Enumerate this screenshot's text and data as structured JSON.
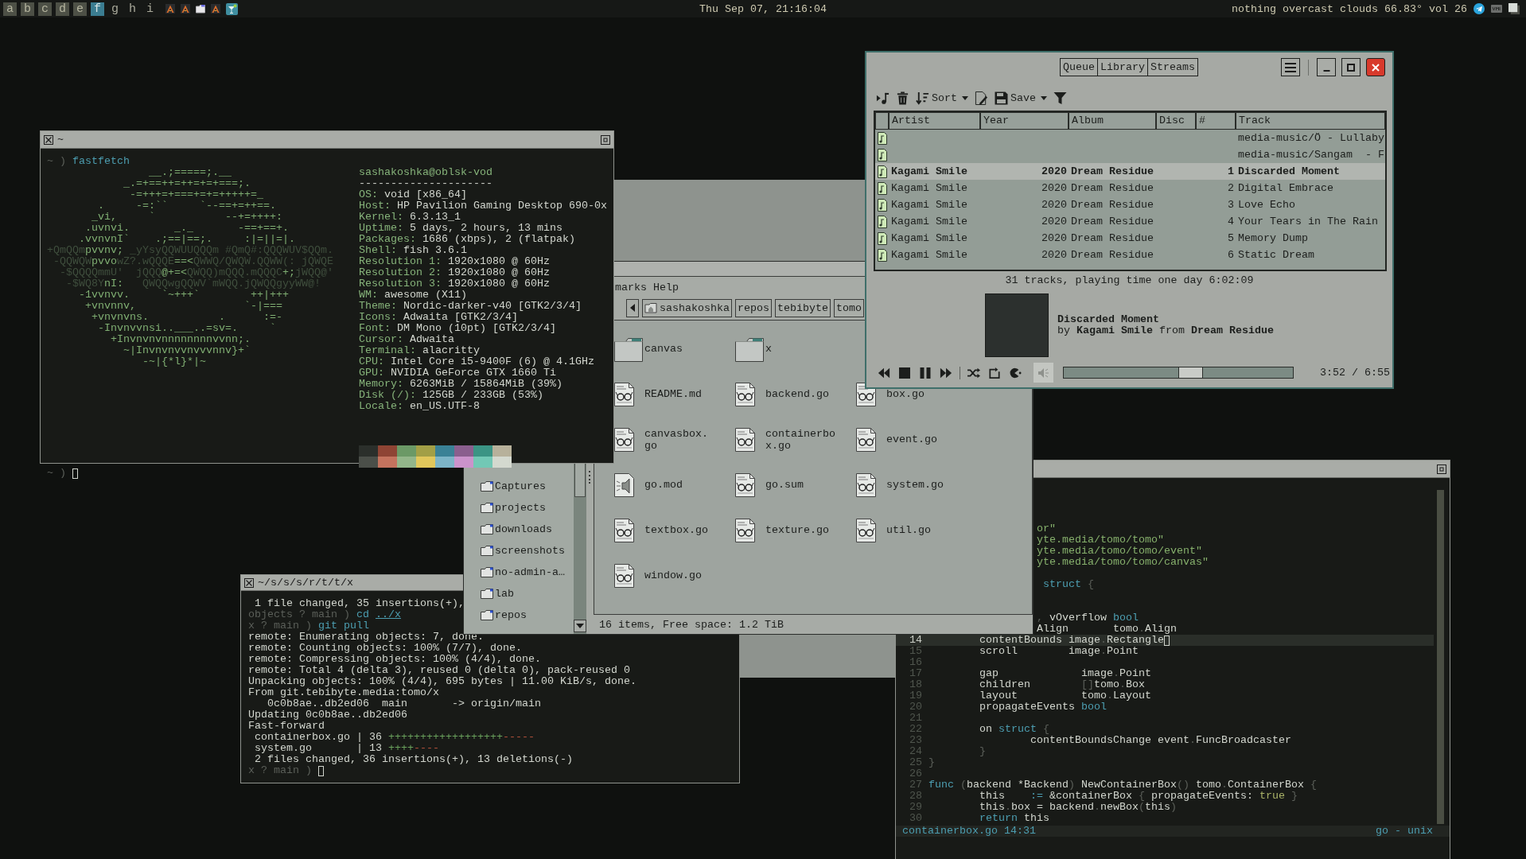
{
  "top_bar": {
    "tags": [
      {
        "label": "a",
        "occupied": true,
        "selected": false
      },
      {
        "label": "b",
        "occupied": true,
        "selected": false
      },
      {
        "label": "c",
        "occupied": true,
        "selected": false
      },
      {
        "label": "d",
        "occupied": true,
        "selected": false
      },
      {
        "label": "e",
        "occupied": true,
        "selected": false
      },
      {
        "label": "f",
        "occupied": true,
        "selected": true
      },
      {
        "label": "g",
        "occupied": false,
        "selected": false
      },
      {
        "label": "h",
        "occupied": false,
        "selected": false
      },
      {
        "label": "i",
        "occupied": false,
        "selected": false
      }
    ],
    "clock": "Thu Sep 07, 21:16:04",
    "weather": "nothing overcast clouds 66.83°",
    "volume": "vol 26"
  },
  "fetch_terminal": {
    "title": "~",
    "command": [
      {
        "text": "~ )",
        "kind": "prompt"
      },
      {
        "text": " fastfetch",
        "kind": "command"
      }
    ],
    "logo": [
      [
        {
          "text": "                __.;=====;.__",
          "kind": "bright"
        }
      ],
      [
        {
          "text": "            _.=+==++=++=+=+===;.",
          "kind": "bright"
        }
      ],
      [
        {
          "text": "             -=+++=+===+=+=+++++=_",
          "kind": "bright"
        }
      ],
      [
        {
          "text": "        .     -=:``     `--==+=++==.",
          "kind": "bright"
        }
      ],
      [
        {
          "text": "       _vi,     `           --+=++++:",
          "kind": "bright"
        }
      ],
      [
        {
          "text": "      .uvnvi.       _._       -==+==+.",
          "kind": "bright"
        }
      ],
      [
        {
          "text": "     .vvnvnI`    .;==|==;.     :|=||=|.",
          "kind": "bright"
        }
      ],
      [
        {
          "text": "+QmQQm",
          "kind": "dim"
        },
        {
          "text": "pvvnv;",
          "kind": "bright"
        },
        {
          "text": " _yYsyQQWUUQQQm #QmQ#:QQQWUV$QQm.",
          "kind": "dim"
        }
      ],
      [
        {
          "text": " -QQWQW",
          "kind": "dim"
        },
        {
          "text": "pvvo",
          "kind": "bright"
        },
        {
          "text": "wZ?.wQQQE",
          "kind": "dim"
        },
        {
          "text": "==<",
          "kind": "bright"
        },
        {
          "text": "QWWQ/QWQW.QQWW(: jQWQE",
          "kind": "dim"
        }
      ],
      [
        {
          "text": "  -$QQQQmmU'  jQQQ",
          "kind": "dim"
        },
        {
          "text": "@+=<",
          "kind": "bright"
        },
        {
          "text": "QWQQ)mQQQ.mQQQC",
          "kind": "dim"
        },
        {
          "text": "+;",
          "kind": "bright"
        },
        {
          "text": "jWQQ@'",
          "kind": "dim"
        }
      ],
      [
        {
          "text": "   -$WQ8Y",
          "kind": "dim"
        },
        {
          "text": "nI:",
          "kind": "bright"
        },
        {
          "text": "   QWQQwgQQWV`mWQQ.jQWQQgyyWW@!",
          "kind": "dim"
        }
      ],
      [
        {
          "text": "     -1vvnvv.     `~+++`        ++|+++",
          "kind": "bright"
        }
      ],
      [
        {
          "text": "      +vnvnnv,                 `-|===",
          "kind": "bright"
        }
      ],
      [
        {
          "text": "       +vnvnvns.           .      :=-",
          "kind": "bright"
        }
      ],
      [
        {
          "text": "        -Invnvvnsi..___..=sv=.     `",
          "kind": "bright"
        }
      ],
      [
        {
          "text": "          +Invnvnvnnnnnnnnvvnn;.",
          "kind": "bright"
        }
      ],
      [
        {
          "text": "            ~|Invnvnvvnvvvnnv}+`",
          "kind": "bright"
        }
      ],
      [
        {
          "text": "               -~|{*l}*|~",
          "kind": "bright"
        }
      ]
    ],
    "user_host": "sashakoshka@oblsk-vod",
    "separator": "---------------------",
    "fields": [
      {
        "key": "OS:",
        "value": "void [x86_64]"
      },
      {
        "key": "Host:",
        "value": "HP Pavilion Gaming Desktop 690-0x"
      },
      {
        "key": "Kernel:",
        "value": "6.3.13_1"
      },
      {
        "key": "Uptime:",
        "value": "5 days, 2 hours, 13 mins"
      },
      {
        "key": "Packages:",
        "value": "1686 (xbps), 2 (flatpak)"
      },
      {
        "key": "Shell:",
        "value": "fish 3.6.1"
      },
      {
        "key": "Resolution 1:",
        "value": "1920x1080 @ 60Hz"
      },
      {
        "key": "Resolution 2:",
        "value": "1920x1080 @ 60Hz"
      },
      {
        "key": "Resolution 3:",
        "value": "1920x1080 @ 60Hz"
      },
      {
        "key": "WM:",
        "value": "awesome (X11)"
      },
      {
        "key": "Theme:",
        "value": "Nordic-darker-v40 [GTK2/3/4]"
      },
      {
        "key": "Icons:",
        "value": "Adwaita [GTK2/3/4]"
      },
      {
        "key": "Font:",
        "value": "DM Mono (10pt) [GTK2/3/4]"
      },
      {
        "key": "Cursor:",
        "value": "Adwaita"
      },
      {
        "key": "Terminal:",
        "value": "alacritty"
      },
      {
        "key": "CPU:",
        "value": "Intel Core i5-9400F (6) @ 4.1GHz"
      },
      {
        "key": "GPU:",
        "value": "NVIDIA GeForce GTX 1660 Ti"
      },
      {
        "key": "Memory:",
        "value": "6263MiB / 15864MiB (39%)"
      },
      {
        "key": "Disk (/):",
        "value": "125GB / 233GB (53%)"
      },
      {
        "key": "Locale:",
        "value": "en_US.UTF-8"
      }
    ],
    "palette": [
      {
        "color": "#2b2f2b"
      },
      {
        "color": "#8e4434"
      },
      {
        "color": "#6b9966"
      },
      {
        "color": "#a29f46"
      },
      {
        "color": "#3a8196"
      },
      {
        "color": "#8a5f8e"
      },
      {
        "color": "#3b9484"
      },
      {
        "color": "#b7b19b"
      },
      {
        "color": "#4b4f49"
      },
      {
        "color": "#c4735e"
      },
      {
        "color": "#93b68a"
      },
      {
        "color": "#e1c75b"
      },
      {
        "color": "#7cb4c7"
      },
      {
        "color": "#cb93cb"
      },
      {
        "color": "#72c8b5"
      },
      {
        "color": "#d4d9cf"
      }
    ],
    "prompt": [
      {
        "text": "~ )",
        "kind": "prompt"
      }
    ],
    "cursor": true
  },
  "git_terminal": {
    "title": "~/s/s/s/r/t/t/x",
    "lines": [
      [
        {
          "text": " 1 file changed, 35 insertions(+),",
          "kind": "plain"
        }
      ],
      [
        {
          "text": "objects ? main ) ",
          "kind": "prompt"
        },
        {
          "text": "cd ",
          "kind": "command"
        },
        {
          "text": "../x",
          "kind": "link"
        }
      ],
      [
        {
          "text": "x ? main ) ",
          "kind": "prompt"
        },
        {
          "text": "git pull",
          "kind": "command"
        }
      ],
      [
        {
          "text": "remote: Enumerating objects: 7, done.",
          "kind": "plain"
        }
      ],
      [
        {
          "text": "remote: Counting objects: 100% (7/7), done.",
          "kind": "plain"
        }
      ],
      [
        {
          "text": "remote: Compressing objects: 100% (4/4), done.",
          "kind": "plain"
        }
      ],
      [
        {
          "text": "remote: Total 4 (delta 3), reused 0 (delta 0), pack-reused 0",
          "kind": "plain"
        }
      ],
      [
        {
          "text": "Unpacking objects: 100% (4/4), 695 bytes | 11.00 KiB/s, done.",
          "kind": "plain"
        }
      ],
      [
        {
          "text": "From git.tebibyte.media:tomo/x",
          "kind": "plain"
        }
      ],
      [
        {
          "text": "   0c0b8ae..db2ed06  main       -> origin/main",
          "kind": "plain"
        }
      ],
      [
        {
          "text": "Updating 0c0b8ae..db2ed06",
          "kind": "plain"
        }
      ],
      [
        {
          "text": "Fast-forward",
          "kind": "plain"
        }
      ],
      [
        {
          "text": " containerbox.go | 36 ",
          "kind": "plain"
        },
        {
          "text": "++++++++++++++++++",
          "kind": "added"
        },
        {
          "text": "-----",
          "kind": "removed"
        }
      ],
      [
        {
          "text": " system.go       | 13 ",
          "kind": "plain"
        },
        {
          "text": "++++",
          "kind": "added"
        },
        {
          "text": "----",
          "kind": "removed"
        }
      ],
      [
        {
          "text": " 2 files changed, 36 insertions(+), 13 deletions(-)",
          "kind": "plain"
        }
      ],
      [
        {
          "text": "x ? main )",
          "kind": "prompt"
        }
      ]
    ],
    "cursor": true
  },
  "file_manager": {
    "menu": [
      "marks",
      "Help"
    ],
    "path": [
      {
        "label": "sashakoshka",
        "kind": "home"
      },
      {
        "label": "repos",
        "kind": "folder"
      },
      {
        "label": "tebibyte",
        "kind": "folder"
      },
      {
        "label": "tomo",
        "kind": "folder"
      }
    ],
    "sidebar": [
      "Captures",
      "projects",
      "downloads",
      "screenshots",
      "no-admin-a…",
      "lab",
      "repos"
    ],
    "file_rows": [
      [
        {
          "name": "canvas",
          "kind": "folder"
        },
        {
          "name": "x",
          "kind": "folder"
        }
      ],
      [
        {
          "name": "README.md",
          "kind": "code"
        },
        {
          "name": "backend.go",
          "kind": "code"
        },
        {
          "name": "box.go",
          "kind": "code"
        }
      ],
      [
        {
          "name": "canvasbox.go",
          "kind": "code"
        },
        {
          "name": "containerbox.go",
          "kind": "code"
        },
        {
          "name": "event.go",
          "kind": "code"
        }
      ],
      [
        {
          "name": "go.mod",
          "kind": "audio"
        },
        {
          "name": "go.sum",
          "kind": "code"
        },
        {
          "name": "system.go",
          "kind": "code"
        }
      ],
      [
        {
          "name": "textbox.go",
          "kind": "code"
        },
        {
          "name": "texture.go",
          "kind": "code"
        },
        {
          "name": "util.go",
          "kind": "code"
        }
      ],
      [
        {
          "name": "window.go",
          "kind": "code"
        }
      ]
    ],
    "status": "16 items, Free space: 1.2 TiB"
  },
  "music_player": {
    "tabs": [
      {
        "label": "Queue",
        "selected": false
      },
      {
        "label": "Library",
        "selected": false
      },
      {
        "label": "Streams",
        "selected": false
      }
    ],
    "sort_label": "Sort",
    "save_label": "Save",
    "columns": [
      "Artist",
      "Year",
      "Album",
      "Disc",
      "#",
      "Track"
    ],
    "rows": [
      {
        "track": "media-music/Ö - Lullaby",
        "playing": false
      },
      {
        "track": "media-music/Sangam  - F",
        "playing": false
      },
      {
        "artist": "Kagami Smile",
        "year": "2020",
        "album": "Dream Residue",
        "number": "1",
        "track": "Discarded Moment",
        "playing": true
      },
      {
        "artist": "Kagami Smile",
        "year": "2020",
        "album": "Dream Residue",
        "number": "2",
        "track": "Digital Embrace",
        "playing": false
      },
      {
        "artist": "Kagami Smile",
        "year": "2020",
        "album": "Dream Residue",
        "number": "3",
        "track": "Love Echo",
        "playing": false
      },
      {
        "artist": "Kagami Smile",
        "year": "2020",
        "album": "Dream Residue",
        "number": "4",
        "track": "Your Tears in The Rain",
        "playing": false
      },
      {
        "artist": "Kagami Smile",
        "year": "2020",
        "album": "Dream Residue",
        "number": "5",
        "track": "Memory Dump",
        "playing": false
      },
      {
        "artist": "Kagami Smile",
        "year": "2020",
        "album": "Dream Residue",
        "number": "6",
        "track": "Static Dream",
        "playing": false
      }
    ],
    "summary": "31 tracks, playing time one day 6:02:09",
    "now_playing": {
      "title": "Discarded Moment",
      "byline": "by **Kagami Smile** from **Dream Residue**"
    },
    "seek": {
      "level": 0.56
    },
    "time": "3:52 / 6:55"
  },
  "editor": {
    "lines": [
      {
        "current": false
      },
      {
        "current": false
      },
      {
        "current": false
      },
      {
        "current": false,
        "segments": [
          {
            "text": "or\"",
            "kind": "string"
          }
        ]
      },
      {
        "current": false,
        "segments": [
          {
            "text": "yte.media/tomo/tomo\"",
            "kind": "string"
          }
        ]
      },
      {
        "current": false,
        "segments": [
          {
            "text": "yte.media/tomo/tomo/event\"",
            "kind": "string"
          }
        ]
      },
      {
        "current": false,
        "segments": [
          {
            "text": "yte.media/tomo/tomo/canvas\"",
            "kind": "string"
          }
        ]
      },
      {
        "current": false
      },
      {
        "current": false,
        "segments": [
          {
            "text": " struct",
            "kind": "keyword"
          },
          {
            "text": " {",
            "kind": "punct"
          }
        ]
      },
      {
        "current": false
      },
      {
        "current": false
      },
      {
        "current": false,
        "segments": [
          {
            "text": ",",
            "kind": "punct"
          },
          {
            "text": " vOverflow ",
            "kind": "plain"
          },
          {
            "text": "bool",
            "kind": "keyword"
          }
        ]
      },
      {
        "current": false,
        "segments": [
          {
            "text": "Align       tomo",
            "kind": "plain"
          },
          {
            "text": ".",
            "kind": "punct"
          },
          {
            "text": "Align",
            "kind": "plain"
          }
        ]
      },
      {
        "number": "14",
        "current": true,
        "segments": [
          {
            "text": "\tcontentBounds image",
            "kind": "plain"
          },
          {
            "text": ".",
            "kind": "punct"
          },
          {
            "text": "Rectangle",
            "kind": "plain"
          }
        ]
      },
      {
        "number": "15",
        "current": false,
        "segments": [
          {
            "text": "\tscroll        image",
            "kind": "plain"
          },
          {
            "text": ".",
            "kind": "punct"
          },
          {
            "text": "Point",
            "kind": "plain"
          }
        ]
      },
      {
        "number": "16",
        "current": false
      },
      {
        "number": "17",
        "current": false,
        "segments": [
          {
            "text": "\tgap             image",
            "kind": "plain"
          },
          {
            "text": ".",
            "kind": "punct"
          },
          {
            "text": "Point",
            "kind": "plain"
          }
        ]
      },
      {
        "number": "18",
        "current": false,
        "segments": [
          {
            "text": "\tchildren        ",
            "kind": "plain"
          },
          {
            "text": "[]",
            "kind": "punct"
          },
          {
            "text": "tomo",
            "kind": "plain"
          },
          {
            "text": ".",
            "kind": "punct"
          },
          {
            "text": "Box",
            "kind": "plain"
          }
        ]
      },
      {
        "number": "19",
        "current": false,
        "segments": [
          {
            "text": "\tlayout          tomo",
            "kind": "plain"
          },
          {
            "text": ".",
            "kind": "punct"
          },
          {
            "text": "Layout",
            "kind": "plain"
          }
        ]
      },
      {
        "number": "20",
        "current": false,
        "segments": [
          {
            "text": "\tpropagateEvents ",
            "kind": "plain"
          },
          {
            "text": "bool",
            "kind": "keyword"
          }
        ]
      },
      {
        "number": "21",
        "current": false
      },
      {
        "number": "22",
        "current": false,
        "segments": [
          {
            "text": "\ton ",
            "kind": "plain"
          },
          {
            "text": "struct",
            "kind": "keyword"
          },
          {
            "text": " {",
            "kind": "punct"
          }
        ]
      },
      {
        "number": "23",
        "current": false,
        "segments": [
          {
            "text": "\t\tcontentBoundsChange event",
            "kind": "plain"
          },
          {
            "text": ".",
            "kind": "punct"
          },
          {
            "text": "FuncBroadcaster",
            "kind": "plain"
          }
        ]
      },
      {
        "number": "24",
        "current": false,
        "segments": [
          {
            "text": "\t}",
            "kind": "punct"
          }
        ]
      },
      {
        "number": "25",
        "current": false,
        "segments": [
          {
            "text": "}",
            "kind": "punct"
          }
        ]
      },
      {
        "number": "26",
        "current": false
      },
      {
        "number": "27",
        "current": false,
        "segments": [
          {
            "text": "func",
            "kind": "keyword"
          },
          {
            "text": " (",
            "kind": "punct"
          },
          {
            "text": "backend *Backend",
            "kind": "plain"
          },
          {
            "text": ")",
            "kind": "punct"
          },
          {
            "text": " NewContainerBox",
            "kind": "plain"
          },
          {
            "text": "()",
            "kind": "punct"
          },
          {
            "text": " tomo",
            "kind": "plain"
          },
          {
            "text": ".",
            "kind": "punct"
          },
          {
            "text": "ContainerBox",
            "kind": "plain"
          },
          {
            "text": " {",
            "kind": "punct"
          }
        ]
      },
      {
        "number": "28",
        "current": false,
        "segments": [
          {
            "text": "\tthis    ",
            "kind": "plain"
          },
          {
            "text": ":=",
            "kind": "keyword"
          },
          {
            "text": " &containerBox ",
            "kind": "plain"
          },
          {
            "text": "{",
            "kind": "punct"
          },
          {
            "text": " propagateEvents: ",
            "kind": "plain"
          },
          {
            "text": "true",
            "kind": "literal"
          },
          {
            "text": " }",
            "kind": "punct"
          }
        ]
      },
      {
        "number": "29",
        "current": false,
        "segments": [
          {
            "text": "\tthis",
            "kind": "plain"
          },
          {
            "text": ".",
            "kind": "punct"
          },
          {
            "text": "box = backend",
            "kind": "plain"
          },
          {
            "text": ".",
            "kind": "punct"
          },
          {
            "text": "newBox",
            "kind": "plain"
          },
          {
            "text": "(",
            "kind": "punct"
          },
          {
            "text": "this",
            "kind": "plain"
          },
          {
            "text": ")",
            "kind": "punct"
          }
        ]
      },
      {
        "number": "30",
        "current": false,
        "segments": [
          {
            "text": "\treturn",
            "kind": "keyword"
          },
          {
            "text": " this",
            "kind": "plain"
          }
        ]
      }
    ],
    "status_left": "containerbox.go 14:31",
    "status_right": "go - unix"
  }
}
